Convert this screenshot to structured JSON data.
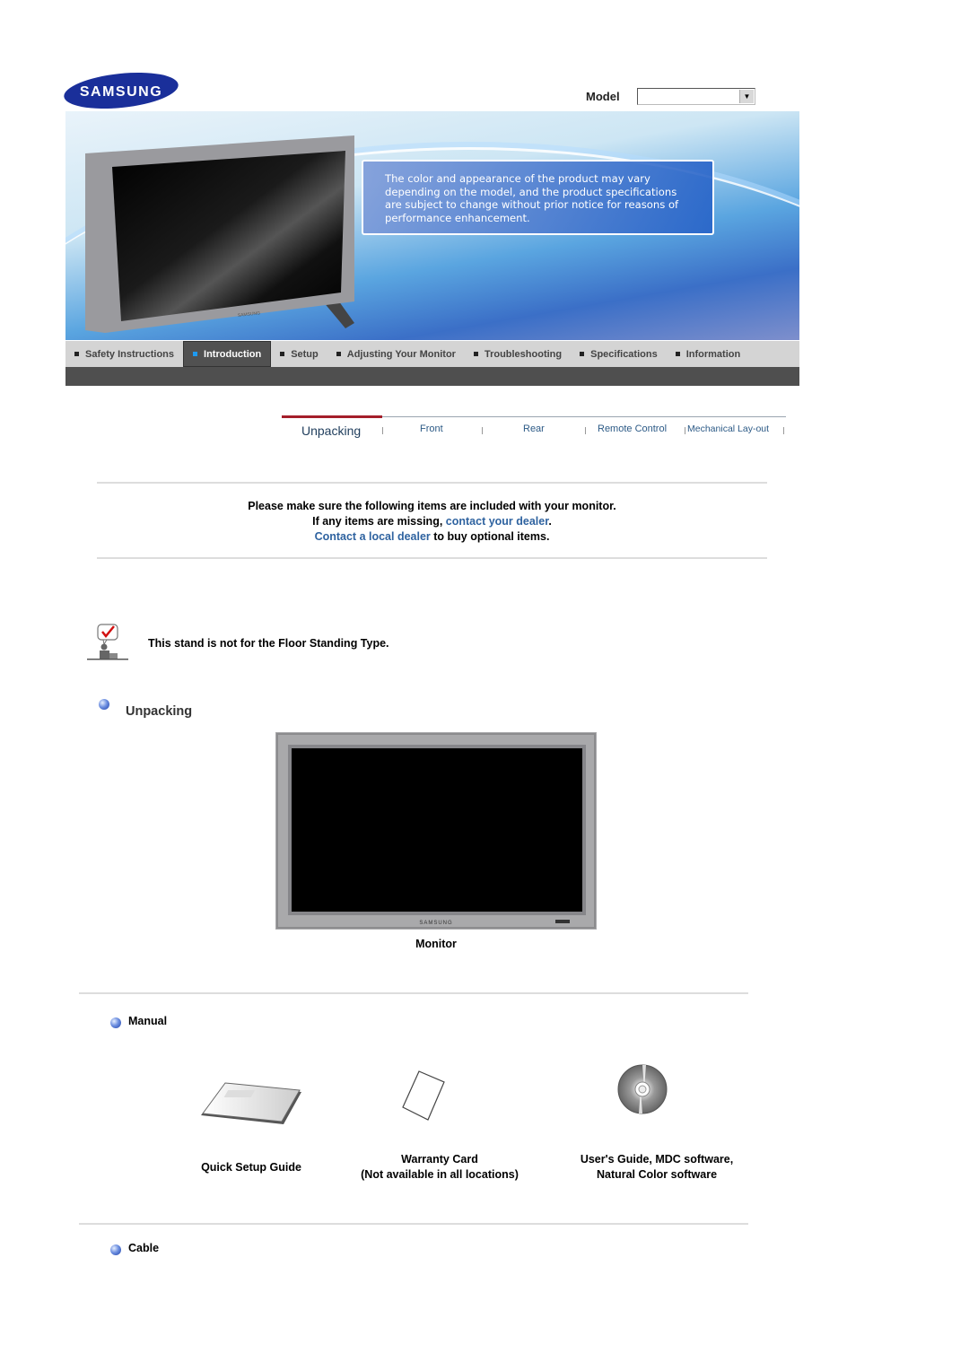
{
  "brand": {
    "logo_text": "SAMSUNG",
    "logo_color": "#1a2f9a"
  },
  "model_selector": {
    "label": "Model",
    "value": ""
  },
  "hero": {
    "notice": "The color and appearance of the product may vary depending on the model, and the product specifications are subject to change without prior notice for reasons of performance enhancement."
  },
  "main_nav": {
    "items": [
      {
        "label": "Safety Instructions",
        "active": false
      },
      {
        "label": "Introduction",
        "active": true
      },
      {
        "label": "Setup",
        "active": false
      },
      {
        "label": "Adjusting Your Monitor",
        "active": false
      },
      {
        "label": "Troubleshooting",
        "active": false
      },
      {
        "label": "Specifications",
        "active": false
      },
      {
        "label": "Information",
        "active": false
      }
    ],
    "active_color": "#1d9af2"
  },
  "sub_tabs": {
    "items": [
      {
        "label": "Unpacking",
        "active": true
      },
      {
        "label": "Front",
        "active": false
      },
      {
        "label": "Rear",
        "active": false
      },
      {
        "label": "Remote Control",
        "active": false
      },
      {
        "label": "Mechanical Lay-out",
        "active": false
      }
    ],
    "active_color": "#a41e2a"
  },
  "intro": {
    "line1": "Please make sure the following items are included with your monitor.",
    "line2_prefix": "If any items are missing, ",
    "line2_link": "contact your dealer",
    "line2_suffix": ".",
    "line3_link": "Contact a local dealer",
    "line3_suffix": " to buy optional items.",
    "link_color": "#2f63a0"
  },
  "note": {
    "text": "This stand is not for the Floor Standing Type."
  },
  "sections": {
    "unpacking": {
      "title": "Unpacking",
      "monitor_caption": "Monitor",
      "monitor_brand": "SAMSUNG"
    },
    "manual": {
      "title": "Manual",
      "items": [
        {
          "line1": "Quick Setup Guide",
          "line2": ""
        },
        {
          "line1": "Warranty Card",
          "line2": "(Not available in all locations)"
        },
        {
          "line1": "User's Guide, MDC software,",
          "line2": "Natural Color software"
        }
      ]
    },
    "cable": {
      "title": "Cable"
    }
  }
}
